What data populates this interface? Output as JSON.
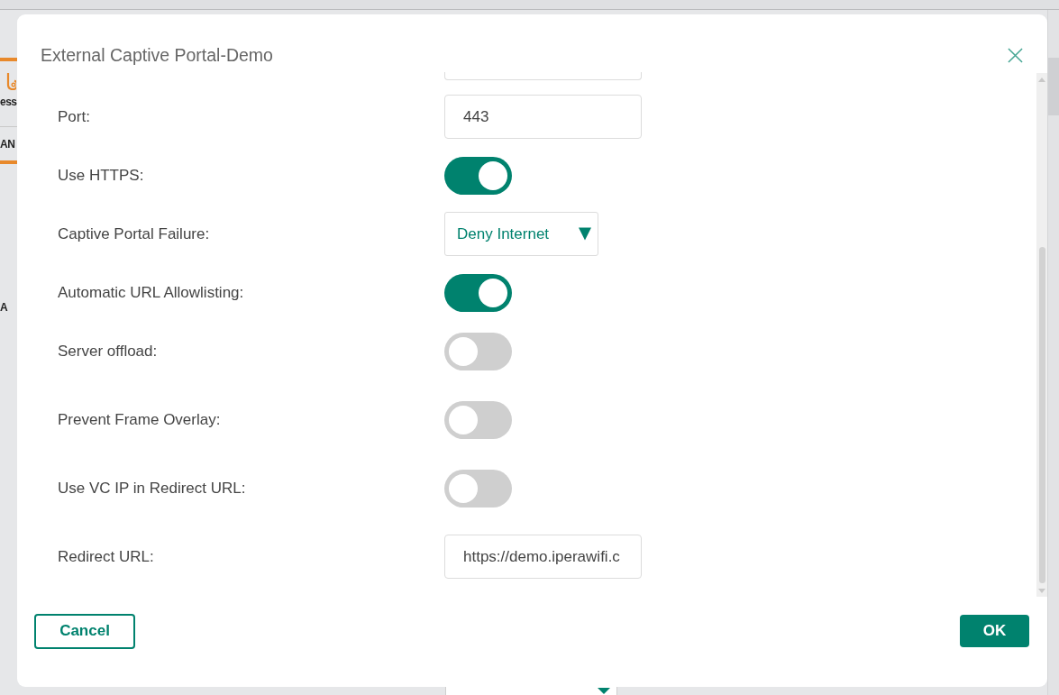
{
  "background": {
    "sidebar_fragments": [
      "ess",
      "AN",
      "A"
    ]
  },
  "dialog": {
    "title": "External Captive Portal-Demo",
    "fields": [
      {
        "kind": "text"
      },
      {
        "kind": "text",
        "label": "Port:",
        "value": "443"
      },
      {
        "kind": "toggle",
        "label": "Use HTTPS:",
        "on": true
      },
      {
        "kind": "select",
        "label": "Captive Portal Failure:",
        "value": "Deny Internet"
      },
      {
        "kind": "toggle",
        "label": "Automatic URL Allowlisting:",
        "on": true
      },
      {
        "kind": "toggle",
        "label": "Server offload:",
        "on": false
      },
      {
        "kind": "toggle",
        "label": "Prevent Frame Overlay:",
        "on": false
      },
      {
        "kind": "toggle",
        "label": "Use VC IP in Redirect URL:",
        "on": false
      },
      {
        "kind": "text",
        "label": "Redirect URL:",
        "value": "https://demo.iperawifi.c"
      }
    ],
    "buttons": [
      {
        "kind": "secondary",
        "label": "Cancel"
      },
      {
        "kind": "primary",
        "label": "OK"
      }
    ]
  }
}
